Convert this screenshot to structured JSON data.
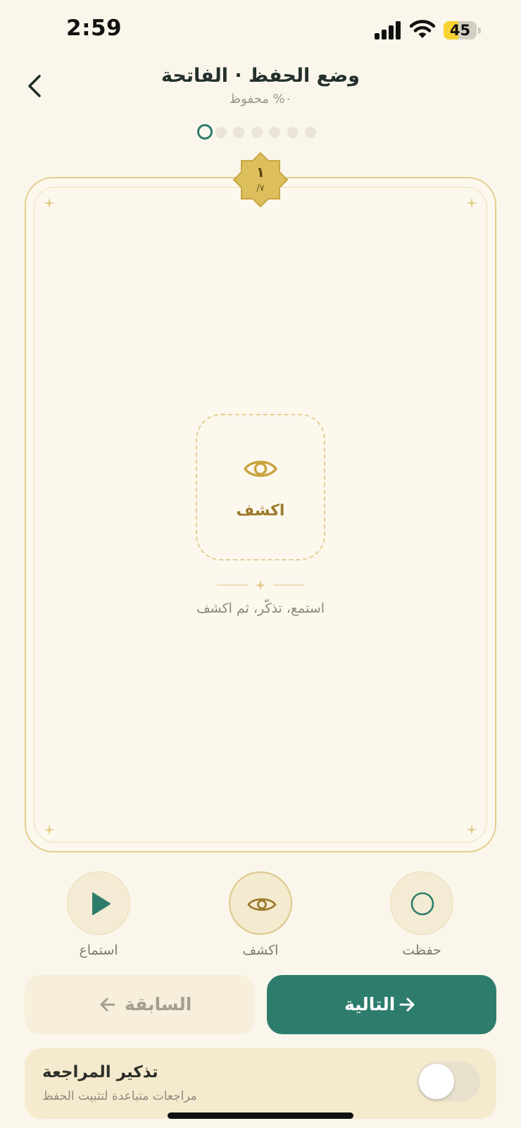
{
  "status_bar": {
    "time": "2:59",
    "battery": "45",
    "battery_level": 0.45
  },
  "header": {
    "title": "وضع الحفظ · الفاتحة",
    "subtitle": "٠% محفوظ",
    "back_icon": "chevron-left-icon",
    "total_pages": 7,
    "current_page": 1
  },
  "card": {
    "badge_number": "١",
    "badge_total": "/٧",
    "reveal_label": "اكشف",
    "hint": "استمع، تذكّر، ثم اكشف"
  },
  "actions": [
    {
      "label": "استماع",
      "icon": "play-icon"
    },
    {
      "label": "اكشف",
      "icon": "eye-icon"
    },
    {
      "label": "حفظت",
      "icon": "circle-icon"
    }
  ],
  "nav": {
    "prev_label": "السابقة",
    "next_label": "التالية"
  },
  "reminder": {
    "title": "تذكير المراجعة",
    "subtitle": "مراجعات متباعدة لتثبيت الحفظ",
    "enabled": false
  },
  "colors": {
    "background": "#FAF6EB",
    "primary": "#2E7D6C",
    "gold": "#D9B956",
    "card_border": "#E4CD8D"
  }
}
